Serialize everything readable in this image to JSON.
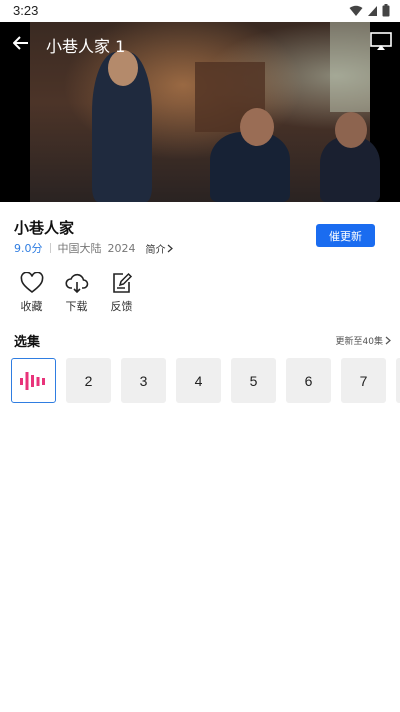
{
  "status_bar": {
    "time": "3:23"
  },
  "video": {
    "title": "小巷人家 1"
  },
  "show": {
    "title": "小巷人家",
    "score": "9.0分",
    "region": "中国大陆",
    "year": "2024",
    "intro_label": "简介",
    "urge_label": "催更新"
  },
  "actions": [
    {
      "label": "收藏",
      "icon": "heart-icon"
    },
    {
      "label": "下载",
      "icon": "cloud-download-icon"
    },
    {
      "label": "反馈",
      "icon": "feedback-icon"
    }
  ],
  "episodes": {
    "heading": "选集",
    "more_label": "更新至40集",
    "items": [
      "2",
      "3",
      "4",
      "5",
      "6",
      "7"
    ]
  },
  "colors": {
    "accent": "#1a6cf0",
    "playing": "#e8337a",
    "score": "#2f7de1"
  }
}
